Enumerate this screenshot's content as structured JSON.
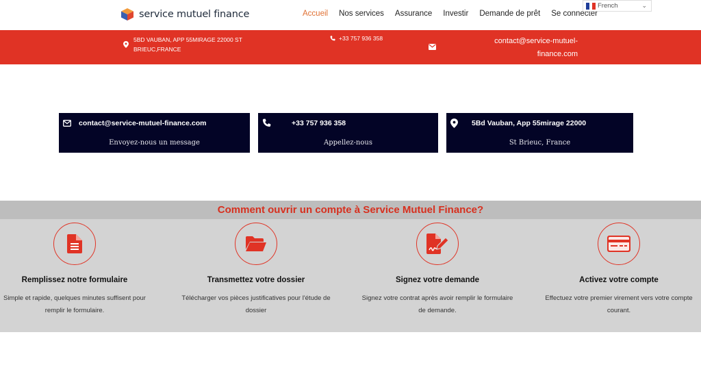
{
  "brand": {
    "name": "service mutuel finance"
  },
  "nav": {
    "items": [
      {
        "label": "Accueil",
        "active": true
      },
      {
        "label": "Nos services",
        "active": false
      },
      {
        "label": "Assurance",
        "active": false
      },
      {
        "label": "Investir",
        "active": false
      },
      {
        "label": "Demande de prêt",
        "active": false
      },
      {
        "label": "Se connecter",
        "active": false
      }
    ]
  },
  "language": {
    "selected": "French"
  },
  "topbar": {
    "address_line1": "5BD VAUBAN, APP 55MIRAGE 22000 ST",
    "address_line2": "BRIEUC,FRANCE",
    "phone": "+33 757 936 358",
    "email_line1": "contact@service-mutuel-",
    "email_line2": "finance.com"
  },
  "cards": [
    {
      "icon": "envelope-icon",
      "title": "contact@service-mutuel-finance.com",
      "subtitle": "Envoyez-nous un message"
    },
    {
      "icon": "phone-icon",
      "title": "+33 757 936 358",
      "subtitle": "Appellez-nous"
    },
    {
      "icon": "map-pin-icon",
      "title": "5Bd Vauban, App 55mirage 22000",
      "subtitle": "St Brieuc, France"
    }
  ],
  "steps": {
    "heading": "Comment ouvrir un compte à Service Mutuel Finance?",
    "items": [
      {
        "icon": "document-icon",
        "title": "Remplissez notre formulaire",
        "text_line1": "Simple et rapide, quelques minutes suffisent pour",
        "text_line2": "remplir le formulaire."
      },
      {
        "icon": "folder-open-icon",
        "title": "Transmettez votre dossier",
        "text_line1": "Télécharger vos pièces justificatives pour l'étude de",
        "text_line2": "dossier"
      },
      {
        "icon": "signature-icon",
        "title": "Signez votre demande",
        "text_line1": "Signez votre contrat après avoir remplir le formulaire",
        "text_line2": "de demande."
      },
      {
        "icon": "credit-card-icon",
        "title": "Activez votre compte",
        "text_line1": "Effectuez votre premier virement vers votre compte",
        "text_line2": "courant."
      }
    ]
  },
  "colors": {
    "accent_red": "#e03325",
    "nav_active": "#e07033",
    "card_bg": "#030426",
    "steps_bg": "#d3d3d3"
  }
}
